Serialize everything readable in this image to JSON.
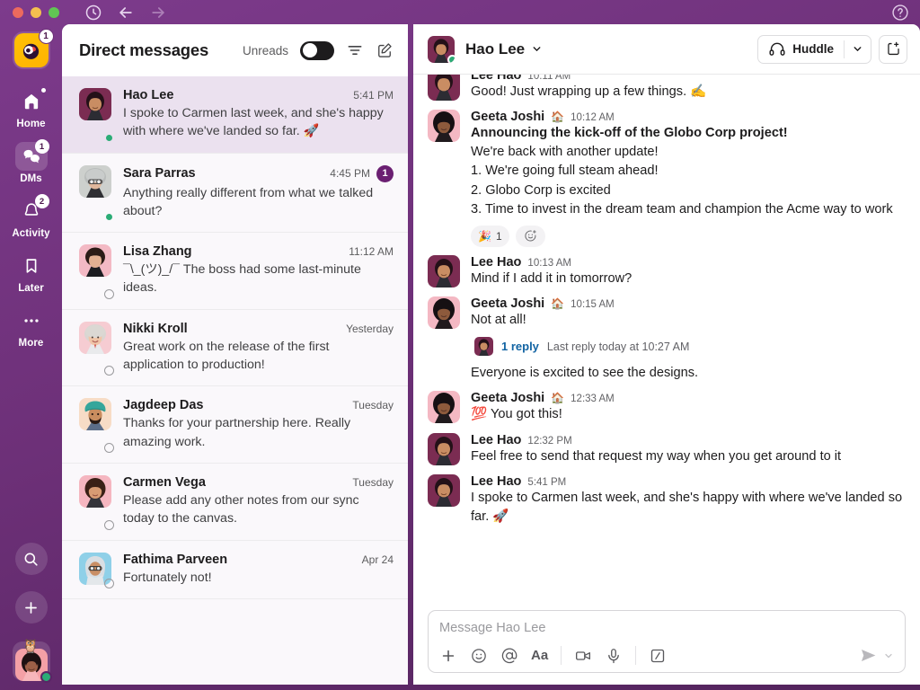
{
  "titlebar": {
    "clock_icon": "clock-icon",
    "back_icon": "back-arrow-icon",
    "forward_icon": "forward-arrow-icon",
    "help_icon": "help-circle-icon"
  },
  "rail": {
    "workspace": {
      "name": "workspace-logo",
      "badge": "1"
    },
    "items": [
      {
        "label": "Home",
        "icon": "home-icon",
        "badge": "",
        "active": false,
        "dot": true
      },
      {
        "label": "DMs",
        "icon": "dms-icon",
        "badge": "1",
        "active": true,
        "dot": false
      },
      {
        "label": "Activity",
        "icon": "bell-icon",
        "badge": "2",
        "active": false,
        "dot": false
      },
      {
        "label": "Later",
        "icon": "bookmark-icon",
        "badge": "",
        "active": false,
        "dot": false
      },
      {
        "label": "More",
        "icon": "ellipsis-icon",
        "badge": "",
        "active": false,
        "dot": false
      }
    ],
    "search_icon": "search-icon",
    "create_icon": "plus-icon",
    "user_status_emoji": "🦉"
  },
  "dm_panel": {
    "title": "Direct messages",
    "unreads_label": "Unreads",
    "unreads_on": false,
    "filter_icon": "filter-icon",
    "compose_icon": "compose-icon",
    "conversations": [
      {
        "name": "Hao Lee",
        "time": "5:41 PM",
        "preview": "I spoke to Carmen last week, and she's happy with where we've landed so far. 🚀",
        "unread": "",
        "presence": "online",
        "selected": true,
        "avatar": "hao"
      },
      {
        "name": "Sara Parras",
        "time": "4:45 PM",
        "preview": "Anything really different from what we talked about?",
        "unread": "1",
        "presence": "online",
        "selected": false,
        "avatar": "sara"
      },
      {
        "name": "Lisa Zhang",
        "time": "11:12 AM",
        "preview": "¯\\_(ツ)_/¯ The boss had some last-minute ideas.",
        "unread": "",
        "presence": "offline",
        "selected": false,
        "avatar": "lisa"
      },
      {
        "name": "Nikki Kroll",
        "time": "Yesterday",
        "preview": "Great work on the release of the first application to production!",
        "unread": "",
        "presence": "offline",
        "selected": false,
        "avatar": "nikki"
      },
      {
        "name": "Jagdeep Das",
        "time": "Tuesday",
        "preview": "Thanks for your partnership here. Really amazing work.",
        "unread": "",
        "presence": "offline",
        "selected": false,
        "avatar": "jagdeep"
      },
      {
        "name": "Carmen Vega",
        "time": "Tuesday",
        "preview": "Please add any other notes from our sync today to the canvas.",
        "unread": "",
        "presence": "offline",
        "selected": false,
        "avatar": "carmen"
      },
      {
        "name": "Fathima Parveen",
        "time": "Apr 24",
        "preview": "Fortunately not!",
        "unread": "",
        "presence": "offline",
        "selected": false,
        "avatar": "fathima"
      }
    ]
  },
  "conversation": {
    "header": {
      "name": "Hao Lee",
      "presence": "online",
      "caret_icon": "chevron-down-icon",
      "huddle_label": "Huddle",
      "huddle_icon": "headphones-icon",
      "huddle_caret_icon": "chevron-down-icon",
      "canvas_icon": "new-canvas-icon"
    },
    "messages": [
      {
        "id": "m0",
        "author": "Lee Hao",
        "time": "10:11 AM",
        "avatar": "hao",
        "clipped": true,
        "lines": [
          {
            "text": "Good! Just wrapping up a few things. ✍️",
            "bold": false
          }
        ]
      },
      {
        "id": "m1",
        "author": "Geeta Joshi",
        "status_emoji": "🏠",
        "time": "10:12 AM",
        "avatar": "geeta",
        "lines": [
          {
            "text": "Announcing the kick-off of the Globo Corp project!",
            "bold": true
          },
          {
            "text": "We're back with another update!",
            "bold": false
          },
          {
            "text": "1. We're going full steam ahead!",
            "bold": false
          },
          {
            "text": "2. Globo Corp is excited",
            "bold": false
          },
          {
            "text": "3. Time to invest in the dream team and champion the Acme way to work",
            "bold": false
          }
        ],
        "reactions": [
          {
            "emoji": "🎉",
            "count": "1"
          }
        ],
        "add_reaction_icon": "add-reaction-icon"
      },
      {
        "id": "m2",
        "author": "Lee Hao",
        "time": "10:13 AM",
        "avatar": "hao",
        "lines": [
          {
            "text": "Mind if I add it in tomorrow?",
            "bold": false
          }
        ]
      },
      {
        "id": "m3",
        "author": "Geeta Joshi",
        "status_emoji": "🏠",
        "time": "10:15 AM",
        "avatar": "geeta",
        "lines": [
          {
            "text": "Not at all!",
            "bold": false
          }
        ],
        "thread": {
          "count_label": "1 reply",
          "last_reply": "Last reply today at 10:27 AM",
          "avatar": "hao"
        },
        "after_thread": "Everyone is excited to see the designs."
      },
      {
        "id": "m4",
        "author": "Geeta Joshi",
        "status_emoji": "🏠",
        "time": "12:33 AM",
        "avatar": "geeta",
        "lines": [
          {
            "text": "💯 You got this!",
            "bold": false
          }
        ]
      },
      {
        "id": "m5",
        "author": "Lee Hao",
        "time": "12:32 PM",
        "avatar": "hao",
        "lines": [
          {
            "text": "Feel free to send that request my way when you get around to it",
            "bold": false
          }
        ]
      },
      {
        "id": "m6",
        "author": "Lee Hao",
        "time": "5:41 PM",
        "avatar": "hao",
        "lines": [
          {
            "text": "I spoke to Carmen last week, and she's happy with where we've landed so far. 🚀",
            "bold": false
          }
        ]
      }
    ],
    "composer": {
      "placeholder": "Message Hao Lee",
      "tools": [
        {
          "icon": "plus-icon",
          "name": "attach-button"
        },
        {
          "icon": "emoji-icon",
          "name": "emoji-button"
        },
        {
          "icon": "mention-icon",
          "name": "mention-button"
        },
        {
          "icon": "format-icon",
          "name": "formatting-button"
        },
        {
          "icon": "video-icon",
          "name": "video-clip-button"
        },
        {
          "icon": "mic-icon",
          "name": "audio-clip-button"
        },
        {
          "icon": "slash-icon",
          "name": "shortcuts-button"
        }
      ],
      "send_icon": "send-icon",
      "send_caret_icon": "chevron-down-icon"
    }
  },
  "colors": {
    "brand_purple": "#6d3078",
    "sidebar_deep": "#52235c",
    "selected_row": "#ebe1ef",
    "unread_badge": "#6b1f72",
    "presence_online": "#2bac76",
    "link_blue": "#1264a3"
  }
}
